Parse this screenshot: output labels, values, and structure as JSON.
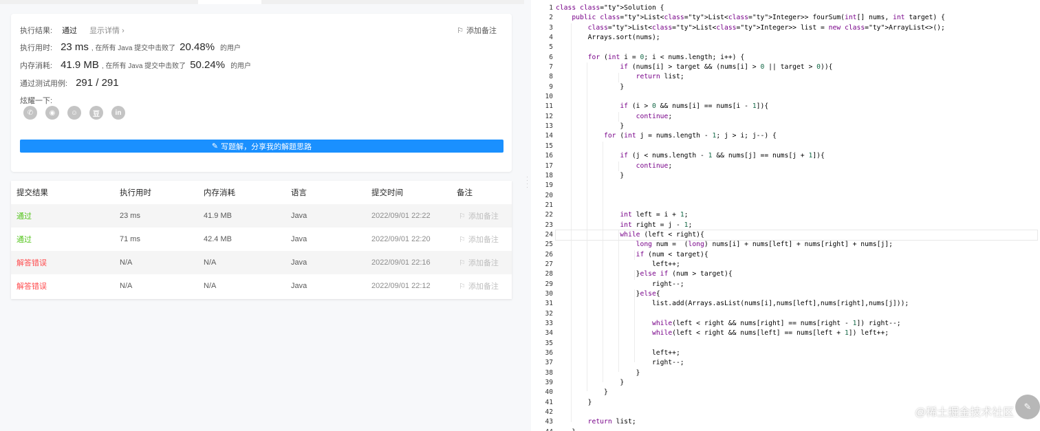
{
  "result": {
    "label_result": "执行结果:",
    "status": "通过",
    "show_detail": "显示详情 ›",
    "add_note": "添加备注",
    "label_runtime": "执行用时:",
    "runtime_value": "23 ms",
    "runtime_mid": ", 在所有 Java 提交中击败了",
    "runtime_pct": "20.48%",
    "runtime_tail": "的用户",
    "label_memory": "内存消耗:",
    "memory_value": "41.9 MB",
    "memory_mid": ", 在所有 Java 提交中击败了",
    "memory_pct": "50.24%",
    "memory_tail": "的用户",
    "label_cases": "通过测试用例:",
    "cases_value": "291 / 291",
    "share_label": "炫耀一下:",
    "social_icons": [
      "wechat-icon",
      "weibo-icon",
      "qq-icon",
      "douban-icon",
      "linkedin-icon"
    ],
    "social_glyphs": [
      "✆",
      "◉",
      "☺",
      "豆",
      "in"
    ],
    "write_button": "写题解，分享我的解题思路"
  },
  "submissions": {
    "headers": [
      "提交结果",
      "执行用时",
      "内存消耗",
      "语言",
      "提交时间",
      "备注"
    ],
    "rows": [
      {
        "status": "通过",
        "runtime": "23 ms",
        "memory": "41.9 MB",
        "lang": "Java",
        "time": "2022/09/01 22:22",
        "note": "添加备注",
        "ok": true
      },
      {
        "status": "通过",
        "runtime": "71 ms",
        "memory": "42.4 MB",
        "lang": "Java",
        "time": "2022/09/01 22:20",
        "note": "添加备注",
        "ok": true
      },
      {
        "status": "解答错误",
        "runtime": "N/A",
        "memory": "N/A",
        "lang": "Java",
        "time": "2022/09/01 22:16",
        "note": "添加备注",
        "ok": false
      },
      {
        "status": "解答错误",
        "runtime": "N/A",
        "memory": "N/A",
        "lang": "Java",
        "time": "2022/09/01 22:12",
        "note": "添加备注",
        "ok": false
      }
    ]
  },
  "editor": {
    "active_line": 24,
    "lines": [
      "class Solution {",
      "    public List<List<Integer>> fourSum(int[] nums, int target) {",
      "        List<List<Integer>> list = new ArrayList<>();",
      "        Arrays.sort(nums);",
      "",
      "        for (int i = 0; i < nums.length; i++) {",
      "                if (nums[i] > target && (nums[i] > 0 || target > 0)){",
      "                    return list;",
      "                }",
      "",
      "                if (i > 0 && nums[i] == nums[i - 1]){",
      "                    continue;",
      "                }",
      "            for (int j = nums.length - 1; j > i; j--) {",
      "",
      "                if (j < nums.length - 1 && nums[j] == nums[j + 1]){",
      "                    continue;",
      "                }",
      "",
      "",
      "",
      "                int left = i + 1;",
      "                int right = j - 1;",
      "                while (left < right){",
      "                    long num =  (long) nums[i] + nums[left] + nums[right] + nums[j];",
      "                    if (num < target){",
      "                        left++;",
      "                    }else if (num > target){",
      "                        right--;",
      "                    }else{",
      "                        list.add(Arrays.asList(nums[i],nums[left],nums[right],nums[j]));",
      "",
      "                        while(left < right && nums[right] == nums[right - 1]) right--;",
      "                        while(left < right && nums[left] == nums[left + 1]) left++;",
      "",
      "                        left++;",
      "                        right--;",
      "                    }",
      "                }",
      "            }",
      "        }",
      "",
      "        return list;",
      "    }",
      "}"
    ]
  },
  "watermark": "@稀土掘金技术社区",
  "fab_glyph": "✎"
}
